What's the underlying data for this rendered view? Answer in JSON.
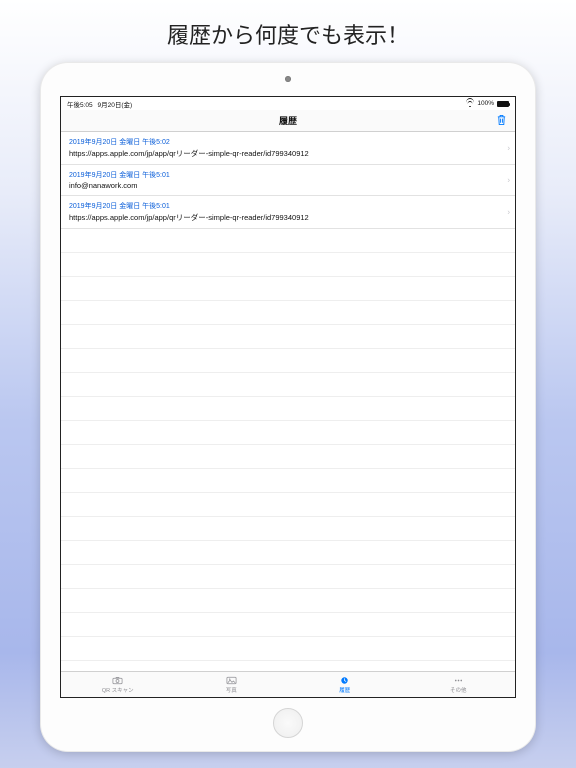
{
  "headline": "履歴から何度でも表示！",
  "status": {
    "time": "午後5:05",
    "date": "9月20日(金)",
    "battery_text": "100%"
  },
  "nav": {
    "title": "履歴"
  },
  "history": [
    {
      "date": "2019年9月20日 金曜日 午後5:02",
      "content": "https://apps.apple.com/jp/app/qrリーダー-simple-qr-reader/id799340912"
    },
    {
      "date": "2019年9月20日 金曜日 午後5:01",
      "content": "info@nanawork.com"
    },
    {
      "date": "2019年9月20日 金曜日 午後5:01",
      "content": "https://apps.apple.com/jp/app/qrリーダー-simple-qr-reader/id799340912"
    }
  ],
  "tabs": {
    "scan": "QR スキャン",
    "photo": "写真",
    "history": "履歴",
    "other": "その他"
  }
}
